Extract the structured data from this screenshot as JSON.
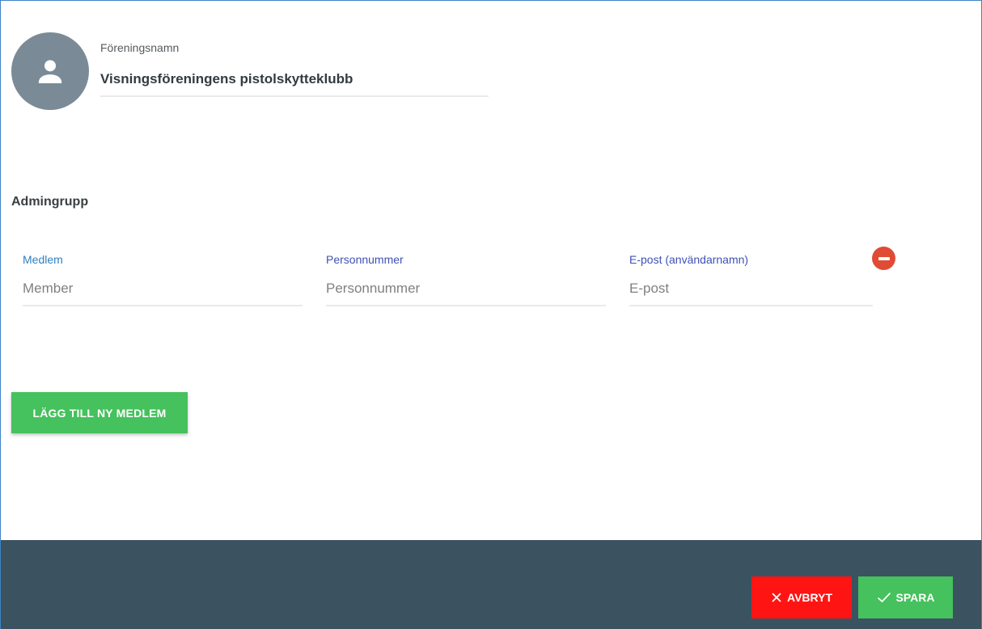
{
  "org": {
    "label": "Föreningsnamn",
    "value": "Visningsföreningens pistolskytteklubb"
  },
  "admin_group": {
    "title": "Admingrupp",
    "fields": {
      "member": {
        "label": "Medlem",
        "placeholder": "Member"
      },
      "personal_number": {
        "label": "Personnummer",
        "placeholder": "Personnummer"
      },
      "email": {
        "label": "E-post (användarnamn)",
        "placeholder": "E-post"
      }
    },
    "add_member_label": "LÄGG TILL NY MEDLEM"
  },
  "footer": {
    "cancel_label": "AVBRYT",
    "save_label": "SPARA"
  },
  "icons": {
    "avatar": "person-icon",
    "remove": "remove-circle-icon",
    "cancel": "close-icon",
    "save": "check-icon"
  },
  "colors": {
    "frame_border": "#3d84c6",
    "avatar_bg": "#7a8b97",
    "label_active": "#2f7fc0",
    "label_inactive": "#3f51b5",
    "remove": "#e04b35",
    "primary_green": "#45c15d",
    "cancel_red": "#ff1414",
    "footer_bg": "#3b5260"
  }
}
